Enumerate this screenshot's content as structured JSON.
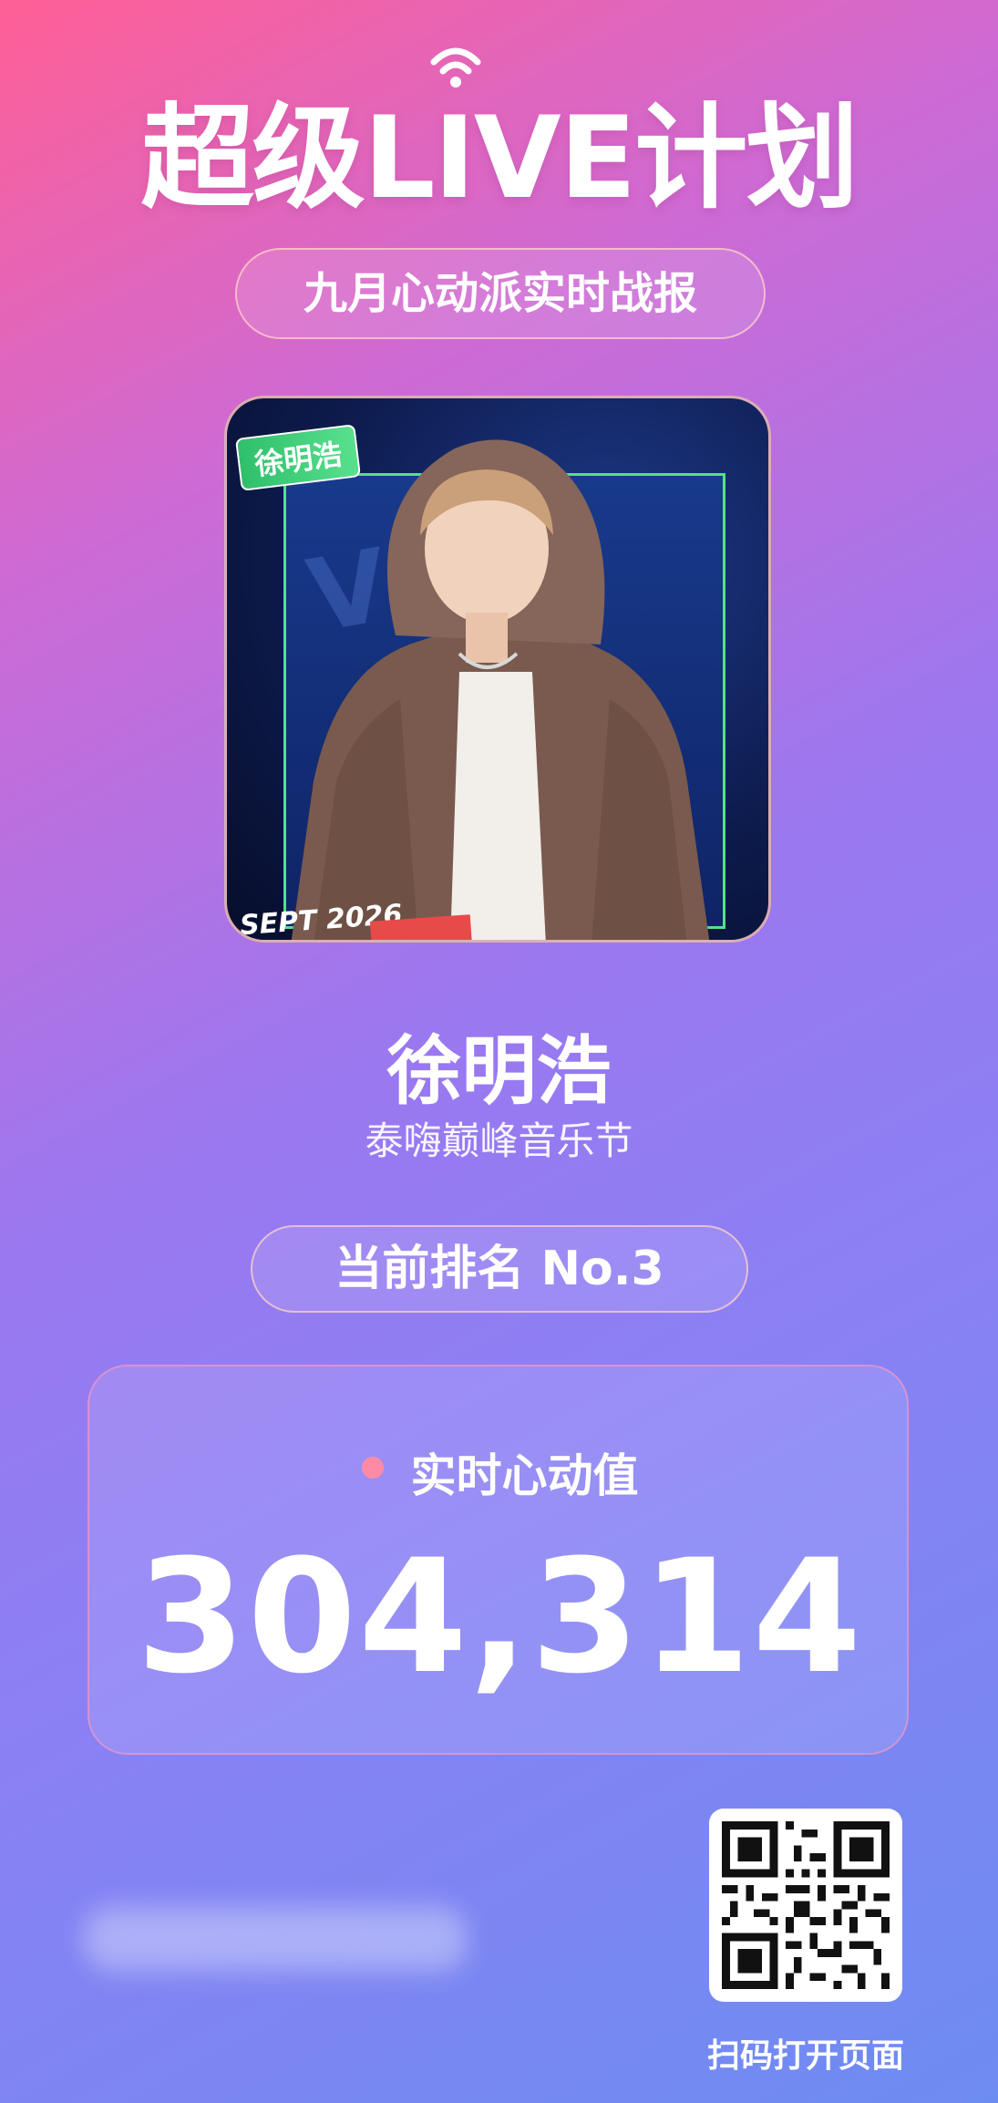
{
  "header": {
    "logo_text": "超级LIVE计划",
    "subtitle": "九月心动派实时战报"
  },
  "artist": {
    "photo_tag": "徐明浩",
    "photo_caption": "SEPT 2026",
    "name": "徐明浩",
    "event": "泰嗨巅峰音乐节"
  },
  "ranking": {
    "label": "当前排名 No.3"
  },
  "score": {
    "label": "实时心动值",
    "value": "304,314"
  },
  "footer": {
    "qr_caption": "扫码打开页面"
  },
  "colors": {
    "gradient_start": "#ff5f95",
    "gradient_mid": "#9a78f0",
    "gradient_end": "#6d8cf2",
    "tag_green": "#2fbf6b",
    "dot_pink": "#ff8aa6"
  },
  "icons": [
    "wifi-signal-icon",
    "qr-code-icon"
  ]
}
